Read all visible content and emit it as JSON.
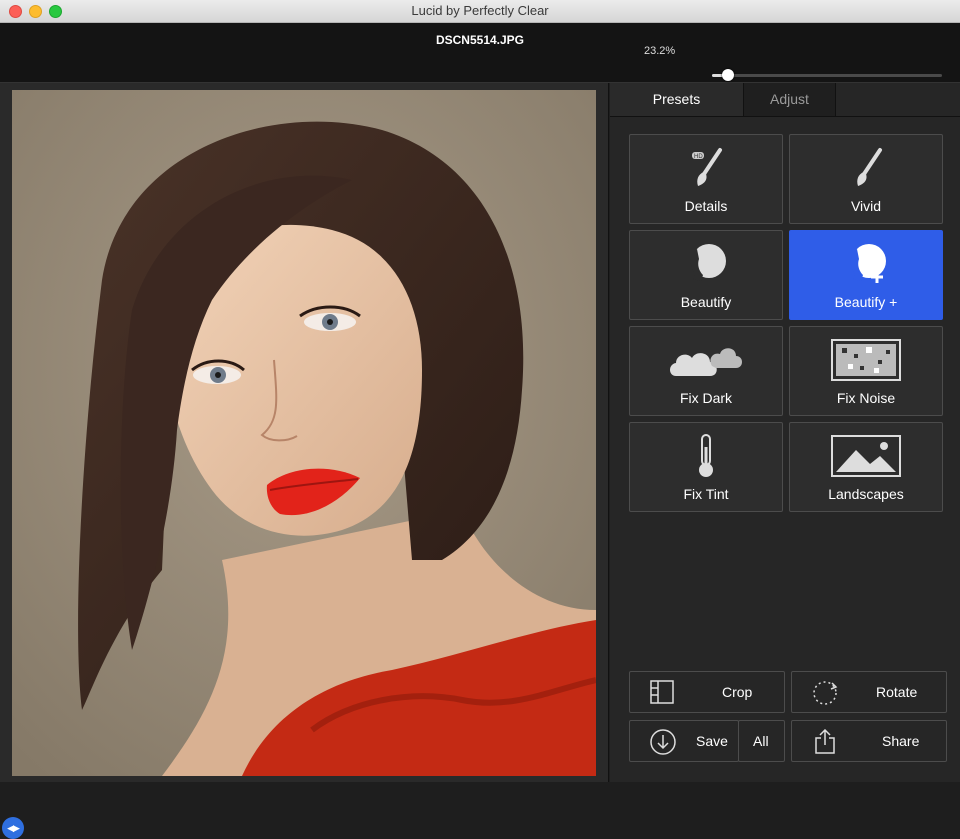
{
  "window": {
    "title": "Lucid by Perfectly Clear"
  },
  "toolbar": {
    "filename": "DSCN5514.JPG",
    "zoom_label": "23.2%",
    "zoom_fraction": 0.07
  },
  "tabs": [
    {
      "label": "Presets",
      "active": true
    },
    {
      "label": "Adjust",
      "active": false
    }
  ],
  "presets": [
    {
      "label": "Details",
      "icon": "brush-hd-icon",
      "selected": false
    },
    {
      "label": "Vivid",
      "icon": "brush-icon",
      "selected": false
    },
    {
      "label": "Beautify",
      "icon": "face-profile-icon",
      "selected": false
    },
    {
      "label": "Beautify +",
      "icon": "face-profile-plus-icon",
      "selected": true
    },
    {
      "label": "Fix Dark",
      "icon": "clouds-icon",
      "selected": false
    },
    {
      "label": "Fix Noise",
      "icon": "noise-icon",
      "selected": false
    },
    {
      "label": "Fix Tint",
      "icon": "thermometer-icon",
      "selected": false
    },
    {
      "label": "Landscapes",
      "icon": "landscape-icon",
      "selected": false
    }
  ],
  "actions": {
    "crop": "Crop",
    "rotate": "Rotate",
    "save": "Save",
    "save_all": "All",
    "share": "Share"
  },
  "colors": {
    "accent": "#2f5de8",
    "panel": "#262626",
    "toolbar": "#141414"
  },
  "image": {
    "description_icon": "portrait-photo"
  }
}
